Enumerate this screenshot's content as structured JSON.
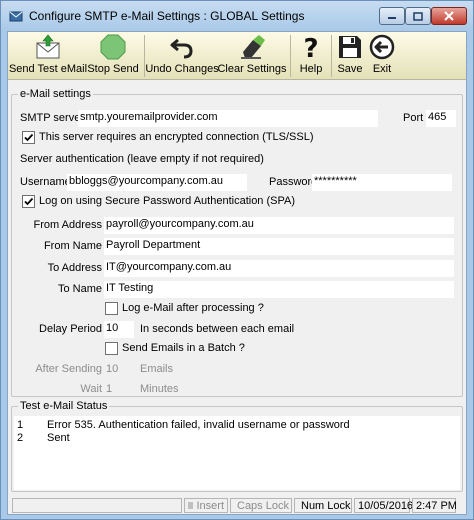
{
  "window": {
    "title": "Configure SMTP e-Mail Settings : GLOBAL Settings"
  },
  "toolbar": {
    "send_test": "Send Test eMail",
    "stop_send": "Stop Send",
    "undo": "Undo Changes",
    "clear": "Clear Settings",
    "help": "Help",
    "save": "Save",
    "exit": "Exit"
  },
  "email_settings": {
    "group_label": "e-Mail settings",
    "smtp_label": "SMTP server",
    "smtp_value": "smtp.youremailprovider.com",
    "port_label": "Port",
    "port_value": "465",
    "tls_label": "This server requires an encrypted connection (TLS/SSL)",
    "tls_checked": true,
    "auth_label": "Server authentication (leave empty if not required)",
    "username_label": "Username",
    "username_value": "bbloggs@yourcompany.com.au",
    "password_label": "Password",
    "password_value": "**********",
    "spa_label": "Log on using Secure Password Authentication (SPA)",
    "spa_checked": true,
    "from_address_label": "From Address",
    "from_address_value": "payroll@yourcompany.com.au",
    "from_name_label": "From Name",
    "from_name_value": "Payroll Department",
    "to_address_label": "To Address",
    "to_address_value": "IT@yourcompany.com.au",
    "to_name_label": "To Name",
    "to_name_value": "IT Testing",
    "log_label": "Log e-Mail after processing ?",
    "log_checked": false,
    "delay_label": "Delay Period",
    "delay_value": "10",
    "delay_hint": "In seconds between each email",
    "batch_label": "Send Emails in a Batch ?",
    "batch_checked": false,
    "after_sending_label": "After Sending",
    "after_sending_value": "10",
    "after_sending_unit": "Emails",
    "wait_label": "Wait",
    "wait_value": "1",
    "wait_unit": "Minutes"
  },
  "status": {
    "group_label": "Test e-Mail Status",
    "rows": [
      {
        "num": "1",
        "msg": "Error 535. Authentication failed, invalid username or password"
      },
      {
        "num": "2",
        "msg": "Sent"
      }
    ]
  },
  "statusbar": {
    "insert": "Insert",
    "caps": "Caps Lock",
    "num": "Num Lock",
    "date": "10/05/2016",
    "time": "2:47 PM"
  },
  "colors": {
    "num_lock_on": "#cc0000",
    "indicator_off": "#c0c0c0",
    "stop_green": "#5cb85c"
  }
}
